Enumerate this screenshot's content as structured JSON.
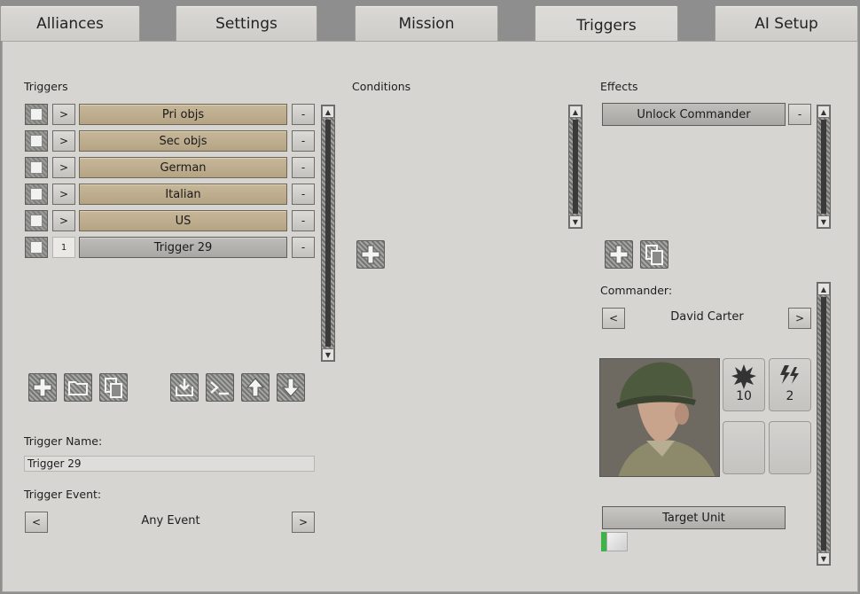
{
  "tabs": [
    {
      "label": "Alliances",
      "active": false
    },
    {
      "label": "Settings",
      "active": false
    },
    {
      "label": "Mission",
      "active": false
    },
    {
      "label": "Triggers",
      "active": true
    },
    {
      "label": "AI Setup",
      "active": false
    }
  ],
  "triggers": {
    "heading": "Triggers",
    "expand_symbol": ">",
    "remove_symbol": "-",
    "rows": [
      {
        "name": "Pri objs",
        "count": ""
      },
      {
        "name": "Sec objs",
        "count": ""
      },
      {
        "name": "German",
        "count": ""
      },
      {
        "name": "Italian",
        "count": ""
      },
      {
        "name": "US",
        "count": ""
      },
      {
        "name": "Trigger 29",
        "count": "1"
      }
    ],
    "toolbar_icons": [
      "add-icon",
      "folder-icon",
      "copy-icon",
      "import-icon",
      "console-icon",
      "arrow-up-icon",
      "arrow-down-icon"
    ],
    "name_label": "Trigger Name:",
    "name_value": "Trigger 29",
    "event_label": "Trigger Event:",
    "event_value": "Any Event",
    "prev_symbol": "<",
    "next_symbol": ">"
  },
  "conditions": {
    "heading": "Conditions"
  },
  "effects": {
    "heading": "Effects",
    "rows": [
      {
        "name": "Unlock Commander"
      }
    ],
    "remove_symbol": "-",
    "commander_label": "Commander:",
    "commander_value": "David Carter",
    "prev_symbol": "<",
    "next_symbol": ">",
    "abilities": [
      {
        "icon": "explosion-icon",
        "value": "10"
      },
      {
        "icon": "lightning-icon",
        "value": "2"
      },
      {
        "icon": "",
        "value": ""
      },
      {
        "icon": "",
        "value": ""
      }
    ],
    "target_unit_label": "Target Unit"
  },
  "colors": {
    "trigger_row": "#b5a484",
    "selected_row": "#a9a8a5",
    "panel": "#d6d5d2",
    "target_unit_flag": "#3fb24a"
  }
}
